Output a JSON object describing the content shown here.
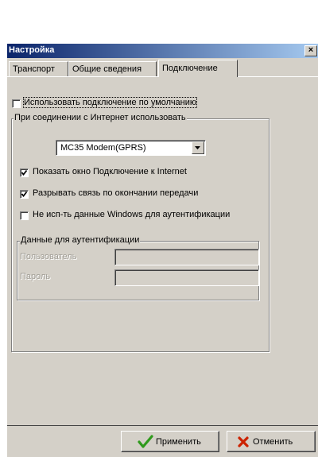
{
  "window": {
    "title": "Настройка",
    "close_glyph": "×"
  },
  "tabs": [
    {
      "label": "Транспорт"
    },
    {
      "label": "Общие сведения"
    },
    {
      "label": "Подключение"
    }
  ],
  "use_default": {
    "label": "Использовать подключение по умолчанию",
    "checked": false
  },
  "internet_group": {
    "legend": "При соединении с Интернет использовать",
    "device": "MC35 Modem(GPRS)",
    "show_window": {
      "label": "Показать окно Подключение к Internet",
      "checked": true
    },
    "disconnect": {
      "label": "Разрывать связь по окончании передачи",
      "checked": true
    },
    "no_windows_auth": {
      "label": "Не исп-ть данные Windows для аутентификации",
      "checked": false
    }
  },
  "auth_group": {
    "legend": "Данные для аутентификации",
    "user_label": "Пользователь",
    "user_value": "",
    "password_label": "Пароль",
    "password_value": ""
  },
  "buttons": {
    "apply": "Применить",
    "cancel": "Отменить"
  },
  "icons": {
    "apply": "checkmark-icon",
    "cancel": "x-icon"
  },
  "colors": {
    "titlebar_start": "#0a246a",
    "titlebar_end": "#a6caf0",
    "apply_icon": "#2f9a1c",
    "cancel_icon": "#cc2200"
  }
}
